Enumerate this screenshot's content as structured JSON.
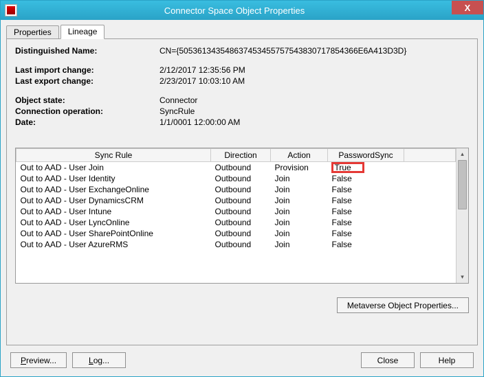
{
  "titlebar": {
    "title": "Connector Space Object Properties",
    "close_label": "X"
  },
  "tabs": {
    "properties": "Properties",
    "lineage": "Lineage"
  },
  "info": {
    "dn_label": "Distinguished Name:",
    "dn_value": "CN={5053613435486374534557575438307178543​66E6A413D3D}",
    "last_import_label": "Last import change:",
    "last_import_value": "2/12/2017 12:35:56 PM",
    "last_export_label": "Last export change:",
    "last_export_value": "2/23/2017 10:03:10 AM",
    "object_state_label": "Object state:",
    "object_state_value": "Connector",
    "connection_op_label": "Connection operation:",
    "connection_op_value": "SyncRule",
    "date_label": "Date:",
    "date_value": "1/1/0001 12:00:00 AM"
  },
  "table": {
    "columns": {
      "sync_rule": "Sync Rule",
      "direction": "Direction",
      "action": "Action",
      "password_sync": "PasswordSync"
    },
    "rows": [
      {
        "sync_rule": "Out to AAD - User Join",
        "direction": "Outbound",
        "action": "Provision",
        "password_sync": "True",
        "highlight": true
      },
      {
        "sync_rule": "Out to AAD - User Identity",
        "direction": "Outbound",
        "action": "Join",
        "password_sync": "False",
        "highlight": false
      },
      {
        "sync_rule": "Out to AAD - User ExchangeOnline",
        "direction": "Outbound",
        "action": "Join",
        "password_sync": "False",
        "highlight": false
      },
      {
        "sync_rule": "Out to AAD - User DynamicsCRM",
        "direction": "Outbound",
        "action": "Join",
        "password_sync": "False",
        "highlight": false
      },
      {
        "sync_rule": "Out to AAD - User Intune",
        "direction": "Outbound",
        "action": "Join",
        "password_sync": "False",
        "highlight": false
      },
      {
        "sync_rule": "Out to AAD - User LyncOnline",
        "direction": "Outbound",
        "action": "Join",
        "password_sync": "False",
        "highlight": false
      },
      {
        "sync_rule": "Out to AAD - User SharePointOnline",
        "direction": "Outbound",
        "action": "Join",
        "password_sync": "False",
        "highlight": false
      },
      {
        "sync_rule": "Out to AAD - User AzureRMS",
        "direction": "Outbound",
        "action": "Join",
        "password_sync": "False",
        "highlight": false
      }
    ]
  },
  "buttons": {
    "metaverse": "Metaverse Object Properties...",
    "preview": "Preview...",
    "log": "Log...",
    "close": "Close",
    "help": "Help"
  }
}
